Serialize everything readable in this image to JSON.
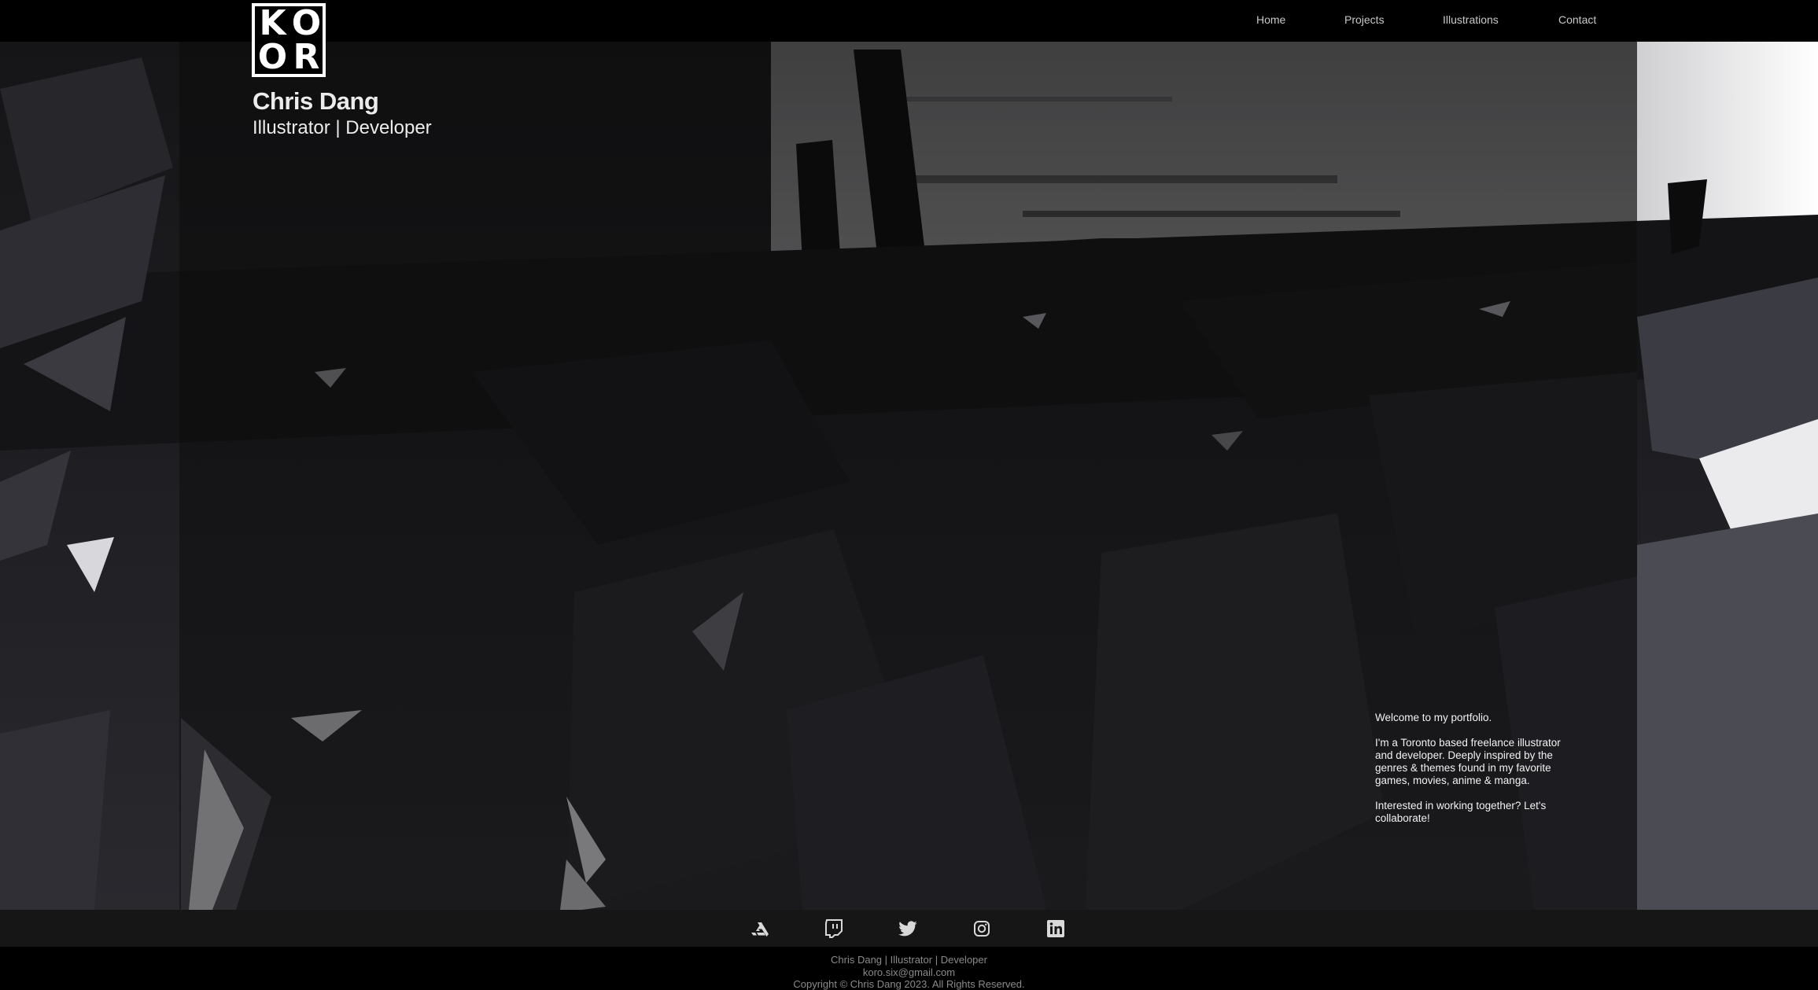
{
  "header": {
    "logo_letters": [
      "K",
      "O",
      "O",
      "R"
    ],
    "name": "Chris Dang",
    "tagline": "Illustrator | Developer",
    "nav": [
      {
        "label": "Home"
      },
      {
        "label": "Projects"
      },
      {
        "label": "Illustrations"
      },
      {
        "label": "Contact"
      }
    ]
  },
  "intro": {
    "welcome": "Welcome to my portfolio.",
    "about": "I'm a Toronto based freelance illustrator and developer. Deeply inspired by the genres & themes found in my favorite games, movies, anime & manga.",
    "cta": "Interested in working together? Let's collaborate!"
  },
  "social": [
    {
      "icon": "artstation-icon"
    },
    {
      "icon": "twitch-icon"
    },
    {
      "icon": "twitter-icon"
    },
    {
      "icon": "instagram-icon"
    },
    {
      "icon": "linkedin-icon"
    }
  ],
  "footer": {
    "line1": "Chris Dang | Illustrator | Developer",
    "email": "koro.six@gmail.com",
    "copyright": "Copyright © Chris Dang 2023. All Rights Reserved."
  },
  "colors": {
    "background": "#000000",
    "text": "#ececec",
    "muted": "#8a8a8a",
    "social_bar": "#161616"
  }
}
